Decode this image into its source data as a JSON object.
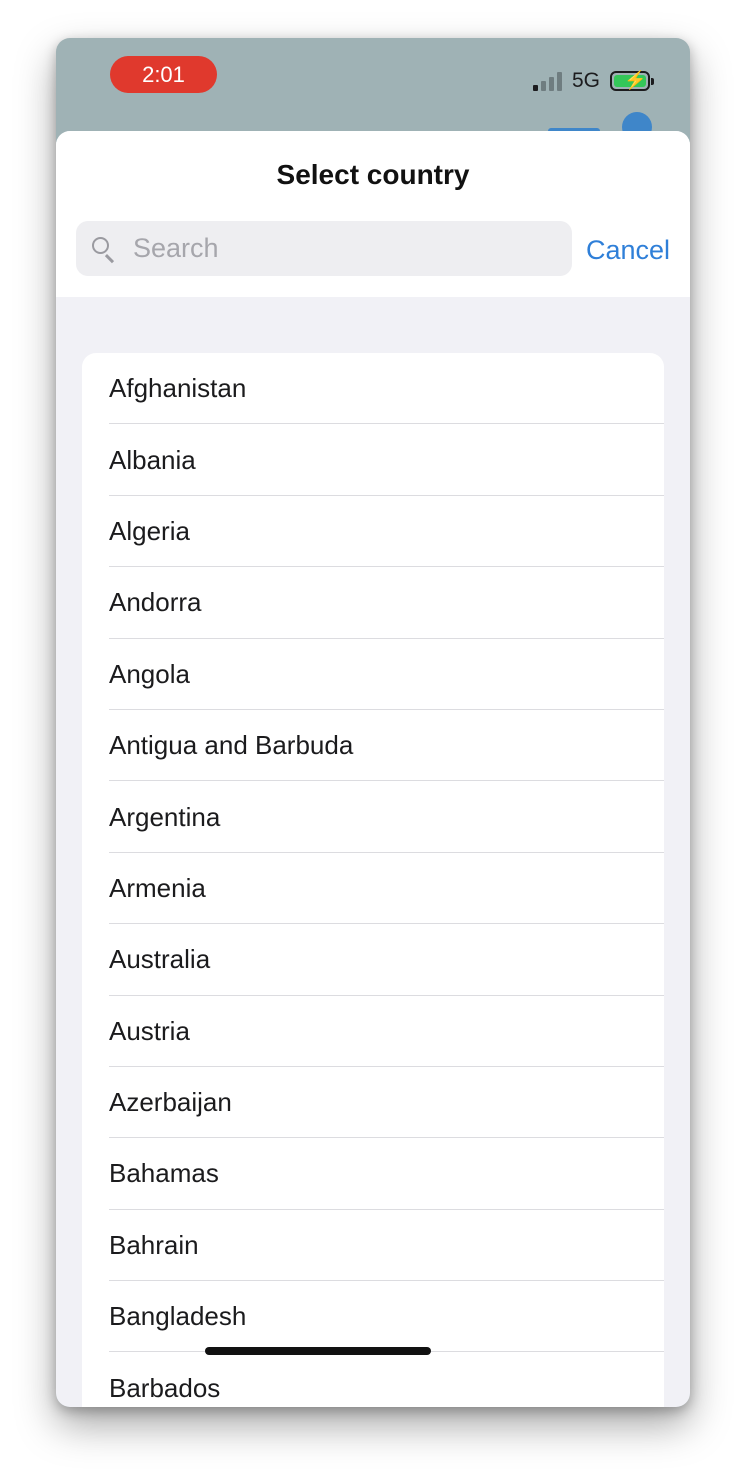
{
  "status_bar": {
    "time": "2:01",
    "network": "5G",
    "colors": {
      "time_pill": "#e0392d",
      "battery_fill": "#34c759"
    }
  },
  "sheet": {
    "title": "Select country",
    "search": {
      "placeholder": "Search",
      "value": ""
    },
    "cancel_label": "Cancel"
  },
  "countries": [
    "Afghanistan",
    "Albania",
    "Algeria",
    "Andorra",
    "Angola",
    "Antigua and Barbuda",
    "Argentina",
    "Armenia",
    "Australia",
    "Austria",
    "Azerbaijan",
    "Bahamas",
    "Bahrain",
    "Bangladesh",
    "Barbados"
  ],
  "colors": {
    "accent": "#2f7fd8"
  }
}
